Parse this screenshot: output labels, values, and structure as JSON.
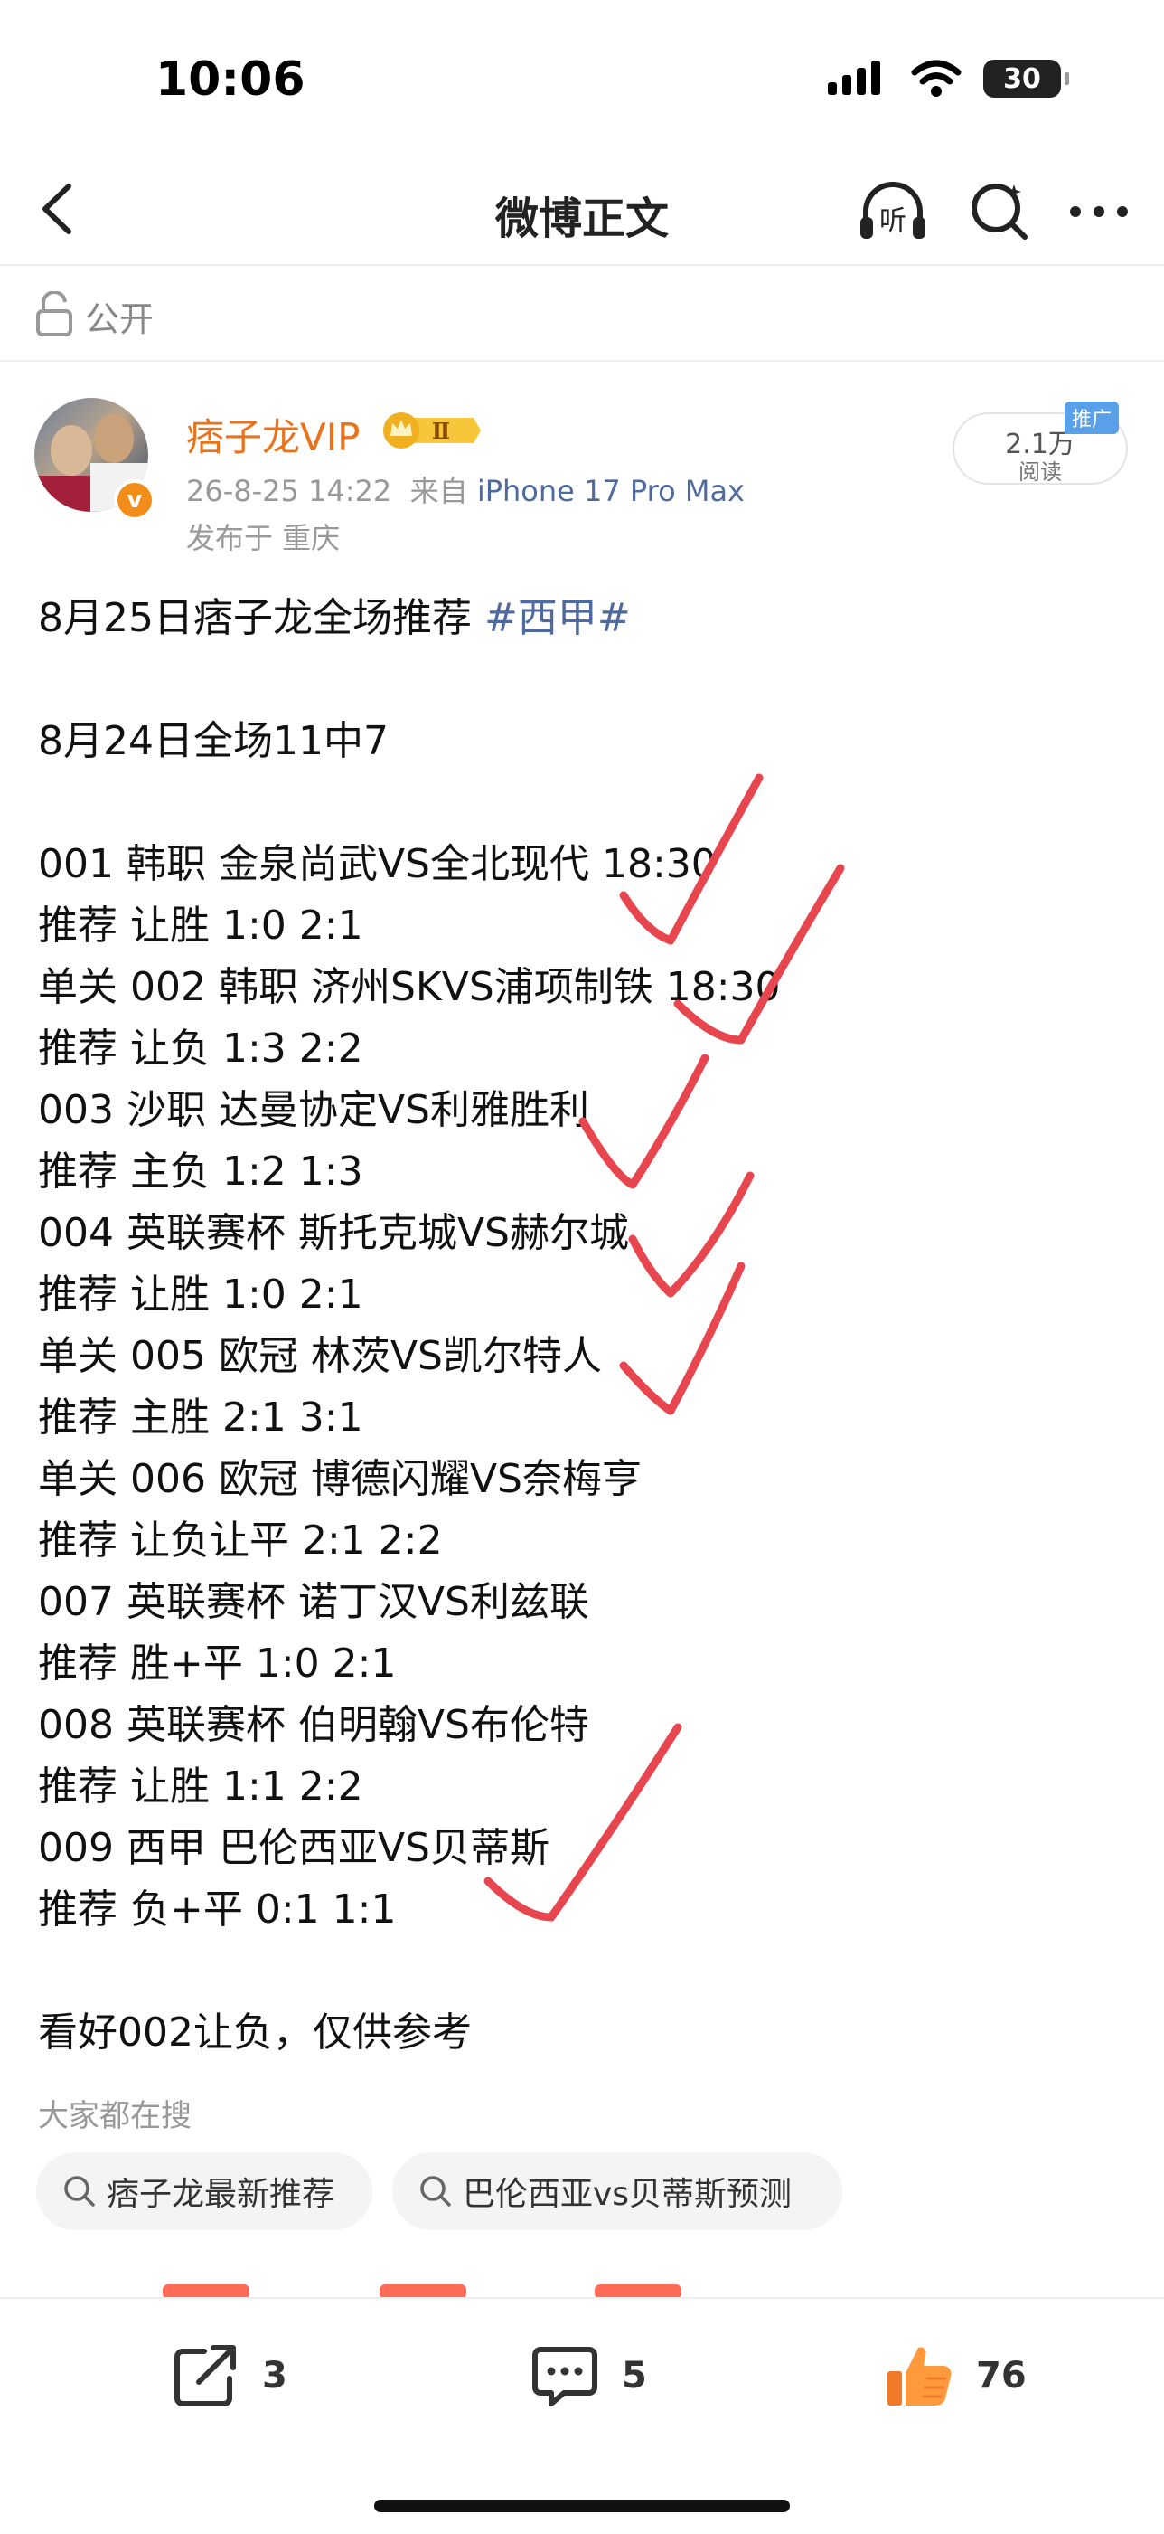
{
  "status_bar": {
    "time": "10:06",
    "battery": "30"
  },
  "nav": {
    "title": "微博正文",
    "listen_label": "听"
  },
  "visibility": {
    "label": "公开"
  },
  "post": {
    "username": "痞子龙VIP",
    "vip_level": "Ⅱ",
    "verified_mark": "v",
    "date": "26-8-25 14:22",
    "source_prefix": "来自",
    "source": "iPhone 17 Pro Max",
    "location": "发布于 重庆",
    "read_count": "2.1万",
    "read_label": "阅读",
    "promo_tag": "推广",
    "title_text": "8月25日痞子龙全场推荐 ",
    "hashtag": "#西甲#",
    "lines": [
      "8月24日全场11中7",
      "",
      "001 韩职 金泉尚武VS全北现代 18:30",
      "推荐 让胜 1:0 2:1",
      "单关 002 韩职 济州SKVS浦项制铁 18:30",
      "推荐 让负 1:3 2:2",
      "003 沙职 达曼协定VS利雅胜利",
      "推荐 主负 1:2 1:3",
      "004 英联赛杯 斯托克城VS赫尔城",
      "推荐 让胜 1:0 2:1",
      "单关 005 欧冠 林茨VS凯尔特人",
      "推荐 主胜 2:1 3:1",
      "单关 006 欧冠 博德闪耀VS奈梅亨",
      "推荐 让负让平 2:1 2:2",
      "007 英联赛杯 诺丁汉VS利兹联",
      "推荐 胜+平 1:0 2:1",
      "008 英联赛杯 伯明翰VS布伦特",
      "推荐 让胜 1:1 2:2",
      "009 西甲 巴伦西亚VS贝蒂斯",
      "推荐 负+平 0:1 1:1",
      "",
      "看好002让负，仅供参考"
    ],
    "check_color": "#e8464f"
  },
  "trending": {
    "title": "大家都在搜",
    "chips": [
      "痞子龙最新推荐",
      "巴伦西亚vs贝蒂斯预测"
    ]
  },
  "actions": {
    "repost_count": "3",
    "comment_count": "5",
    "like_count": "76"
  }
}
